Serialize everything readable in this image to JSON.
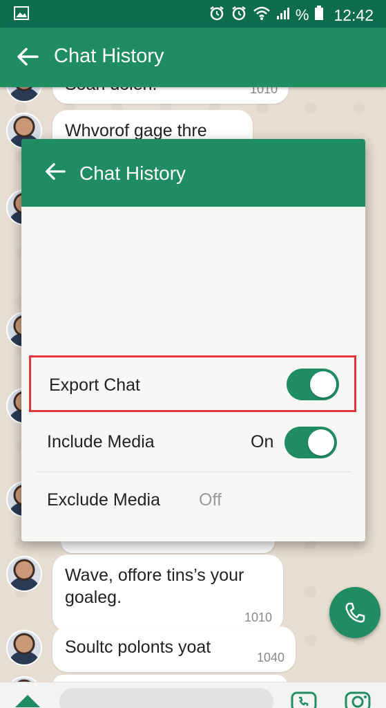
{
  "status_bar": {
    "time": "12:42",
    "battery_label": "%",
    "icons": [
      "image-icon",
      "alarm-icon",
      "alarm-icon",
      "wifi-icon",
      "signal-icon",
      "battery-icon"
    ]
  },
  "app_bar": {
    "title": "Chat History",
    "back_icon": "back-arrow-icon"
  },
  "messages": [
    {
      "text": "Soan dolen.",
      "meta": "1010"
    },
    {
      "text": "Whvorof gage thre",
      "meta": ""
    },
    {
      "text": "Wave, offore tins’s your goaleg.",
      "meta": "1010"
    },
    {
      "text": "Soultc polonts yoat",
      "meta": "1040"
    }
  ],
  "dialog": {
    "title": "Chat History",
    "options": [
      {
        "label": "Export Chat",
        "state": "",
        "on": true,
        "highlighted": true
      },
      {
        "label": "Include Media",
        "state": "On",
        "on": true,
        "highlighted": false
      },
      {
        "label": "Exclude Media",
        "state": "Off",
        "on": false,
        "highlighted": false
      }
    ]
  },
  "colors": {
    "primary": "#1f8c61",
    "status_bar": "#0d6b4e",
    "highlight": "#e0333c"
  },
  "fab": {
    "icon": "phone-icon"
  },
  "bottom_bar": {
    "icons": [
      "home-icon",
      "call-icon",
      "camera-icon"
    ]
  }
}
